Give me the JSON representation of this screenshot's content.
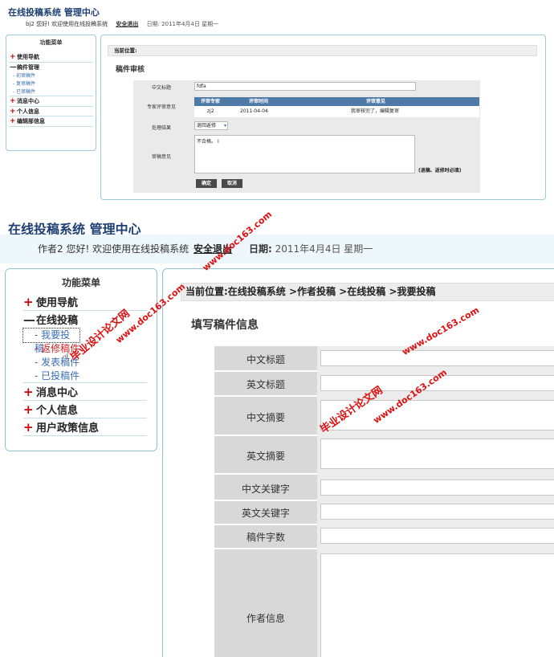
{
  "top": {
    "app_title": "在线投稿系统 管理中心",
    "greeting": "bj2 您好! 欢迎使用在线投稿系统",
    "logout": "安全退出",
    "date": "日期: 2011年4月4日 星期一",
    "sidebar": {
      "title": "功能菜单",
      "items": [
        {
          "label": "使用导航",
          "prefix": "+"
        },
        {
          "label": "稿件管理",
          "prefix": "—"
        },
        {
          "label": "初审稿件",
          "prefix": "-"
        },
        {
          "label": "复审稿件",
          "prefix": "-"
        },
        {
          "label": "已审稿件",
          "prefix": "-"
        },
        {
          "label": "消息中心",
          "prefix": "+"
        },
        {
          "label": "个人信息",
          "prefix": "+"
        },
        {
          "label": "编辑部信息",
          "prefix": "+"
        }
      ]
    },
    "location_label": "当前位置:",
    "page_heading": "稿件审核",
    "form": {
      "title_label": "中文标题",
      "title_value": "fdfa",
      "review_label": "专家评审意见",
      "review_headers": [
        "评审专家",
        "评审时间",
        "评审意见"
      ],
      "review_row": [
        "zj2",
        "2011-04-04",
        "我审核完了，编辑复审"
      ],
      "result_label": "处理结果",
      "result_value": "退回返修",
      "opinion_label": "审稿意见",
      "opinion_value": "不合格。",
      "opinion_hint": "(退稿、返修时必填)",
      "confirm": "确定",
      "cancel": "取消"
    }
  },
  "bottom": {
    "app_title": "在线投稿系统 管理中心",
    "greeting": "作者2 您好! 欢迎使用在线投稿系统",
    "logout": "安全退出",
    "date_label": "日期:",
    "date_value": "2011年4月4日 星期一",
    "sidebar": {
      "title": "功能菜单",
      "items": [
        {
          "label": "使用导航",
          "prefix": "+"
        },
        {
          "label": "在线投稿",
          "prefix": "—"
        },
        {
          "label": "我要投稿",
          "prefix": "-"
        },
        {
          "label": "返修稿件",
          "prefix": "-"
        },
        {
          "label": "发表稿件",
          "prefix": "-"
        },
        {
          "label": "已投稿件",
          "prefix": "-"
        },
        {
          "label": "消息中心",
          "prefix": "+"
        },
        {
          "label": "个人信息",
          "prefix": "+"
        },
        {
          "label": "用户政策信息",
          "prefix": "+"
        }
      ]
    },
    "location": "当前位置:在线投稿系统 >作者投稿 >在线投稿 >我要投稿",
    "page_heading": "填写稿件信息",
    "fields": [
      "中文标题",
      "英文标题",
      "中文摘要",
      "英文摘要",
      "中文关键字",
      "英文关键字",
      "稿件字数",
      "作者信息"
    ]
  },
  "watermarks": {
    "url": "www.doc163.com",
    "site": "毕业设计论文网"
  },
  "colors": {
    "accent_blue": "#1d3f73",
    "plus_red": "#cc0000",
    "border_blue": "#8fc3da",
    "table_header": "#4e7aa8"
  }
}
